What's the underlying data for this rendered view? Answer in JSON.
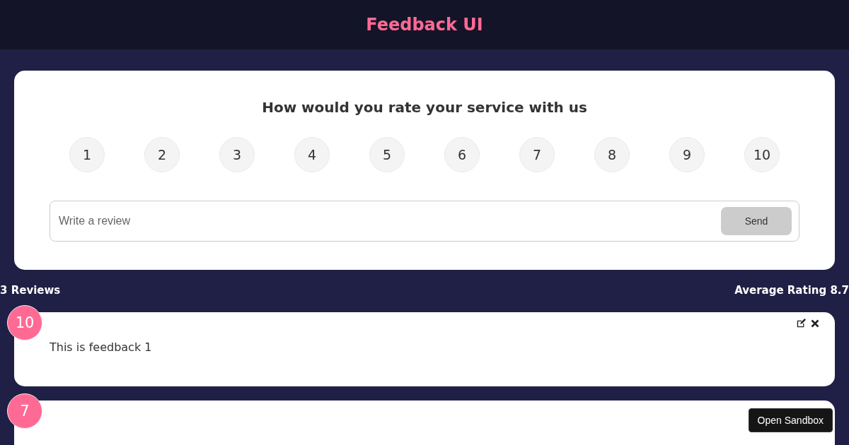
{
  "header": {
    "title": "Feedback UI"
  },
  "rating_form": {
    "question": "How would you rate your service with us",
    "ratings": [
      {
        "label": "1",
        "selected": false
      },
      {
        "label": "2",
        "selected": false
      },
      {
        "label": "3",
        "selected": false
      },
      {
        "label": "4",
        "selected": false
      },
      {
        "label": "5",
        "selected": false
      },
      {
        "label": "6",
        "selected": false
      },
      {
        "label": "7",
        "selected": false
      },
      {
        "label": "8",
        "selected": false
      },
      {
        "label": "9",
        "selected": false
      },
      {
        "label": "10",
        "selected": false
      }
    ],
    "review_field": {
      "placeholder": "Write a review"
    },
    "send_button": {
      "label": "Send",
      "disabled": true
    }
  },
  "stats": {
    "count": "3 Reviews",
    "average": "Average Rating 8.7"
  },
  "reviews": [
    {
      "rating": "10",
      "text": "This is feedback 1",
      "actions": true
    },
    {
      "rating": "7",
      "actions": false
    }
  ],
  "overlay_button": "Open Sandbox"
}
